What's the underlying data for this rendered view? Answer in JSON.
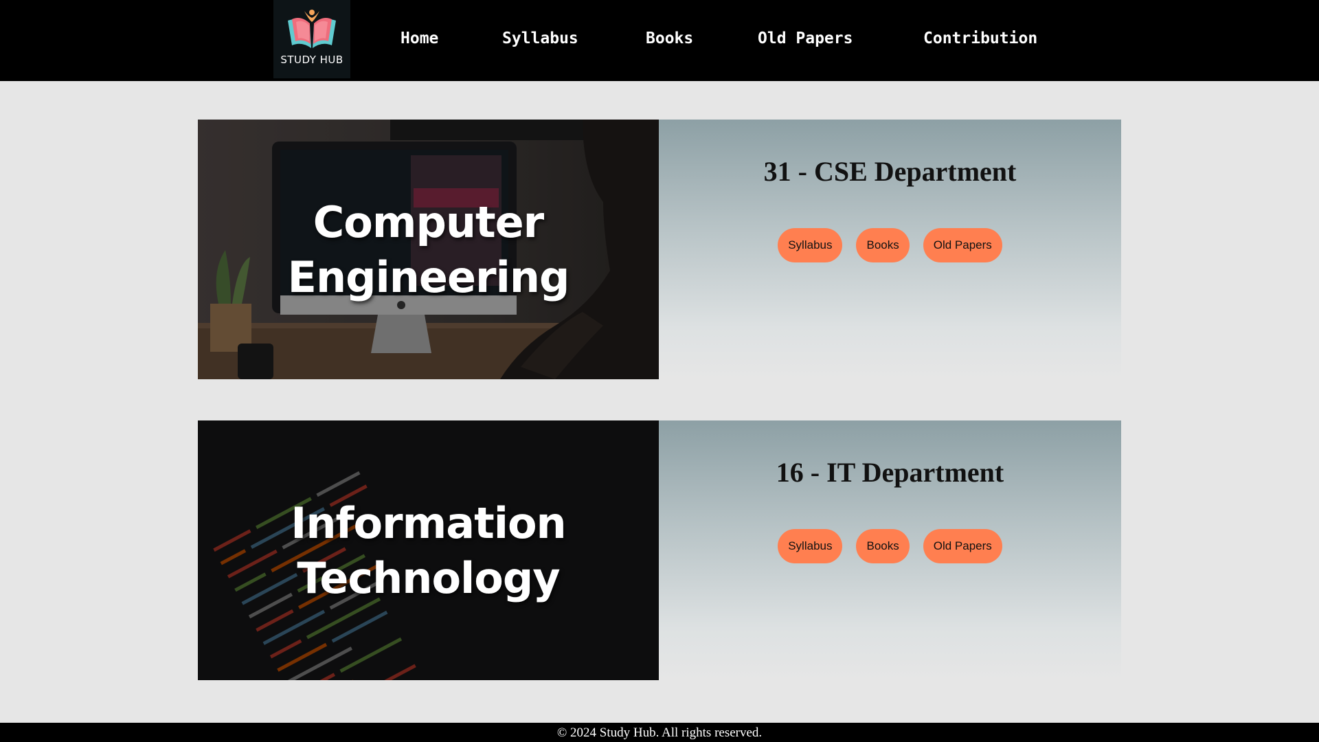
{
  "brand": {
    "logo_text": "STUDY HUB"
  },
  "nav": {
    "items": [
      "Home",
      "Syllabus",
      "Books",
      "Old Papers",
      "Contribution"
    ]
  },
  "departments": [
    {
      "image_title_line1": "Computer",
      "image_title_line2": "Engineering",
      "title": "31 - CSE Department",
      "buttons": [
        "Syllabus",
        "Books",
        "Old Papers"
      ],
      "image_icon": "desktop-computer-photo"
    },
    {
      "image_title_line1": "Information",
      "image_title_line2": "Technology",
      "title": "16 - IT Department",
      "buttons": [
        "Syllabus",
        "Books",
        "Old Papers"
      ],
      "image_icon": "source-code-screen-photo"
    }
  ],
  "footer": {
    "text": "© 2024 Study Hub. All rights reserved."
  },
  "colors": {
    "header_bg": "#000000",
    "page_bg": "#e6e6e6",
    "button_bg": "#ff7f50",
    "info_gradient_top": "#8da0a5"
  }
}
